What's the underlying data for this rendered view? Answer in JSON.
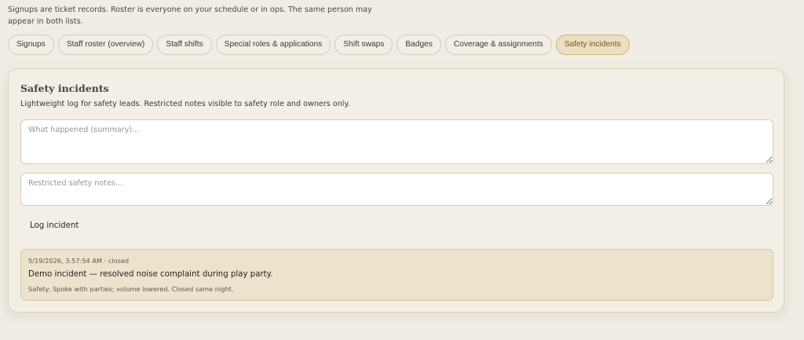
{
  "intro": "Signups are ticket records. Roster is everyone on your schedule or in ops. The same person may appear in both lists.",
  "tabs": [
    {
      "label": "Signups",
      "active": false
    },
    {
      "label": "Staff roster (overview)",
      "active": false
    },
    {
      "label": "Staff shifts",
      "active": false
    },
    {
      "label": "Special roles & applications",
      "active": false
    },
    {
      "label": "Shift swaps",
      "active": false
    },
    {
      "label": "Badges",
      "active": false
    },
    {
      "label": "Coverage & assignments",
      "active": false
    },
    {
      "label": "Safety incidents",
      "active": true
    }
  ],
  "panel": {
    "title": "Safety incidents",
    "description": "Lightweight log for safety leads. Restricted notes visible to safety role and owners only.",
    "summary_placeholder": "What happened (summary)...",
    "notes_placeholder": "Restricted safety notes...",
    "summary_value": "",
    "notes_value": "",
    "log_button_label": "Log incident"
  },
  "incidents": [
    {
      "meta": "5/19/2026, 3:57:54 AM · closed",
      "title": "Demo incident — resolved noise complaint during play party.",
      "notes": "Safety: Spoke with parties; volume lowered. Closed same night."
    }
  ],
  "colors": {
    "background": "#f1ede5",
    "active_tab": "#ebdfc0",
    "incident_card": "#ece3cc"
  }
}
